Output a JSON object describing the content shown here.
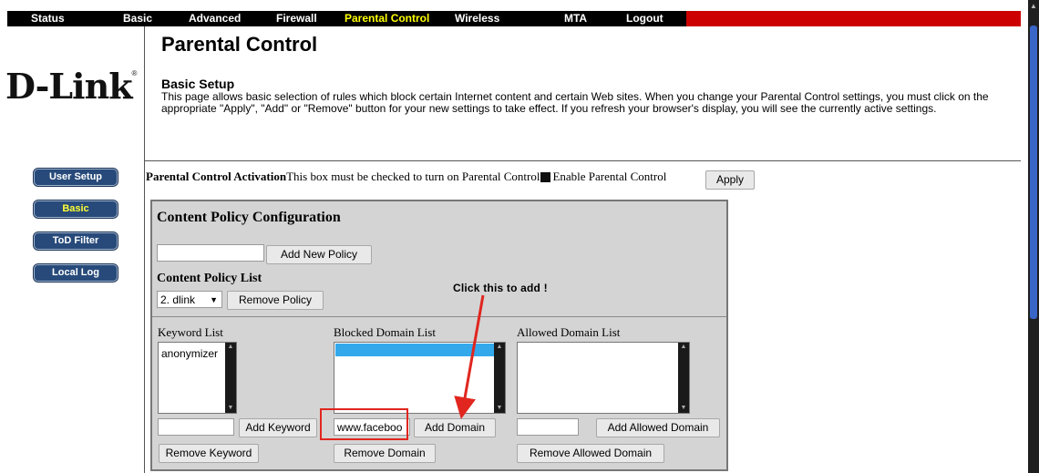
{
  "nav": {
    "items": [
      "Status",
      "Basic",
      "Advanced",
      "Firewall",
      "Parental Control",
      "Wireless",
      "MTA",
      "Logout"
    ],
    "active": "Parental Control"
  },
  "logo": {
    "text": "D-Link",
    "mark": "®"
  },
  "sidebar": {
    "items": [
      "User Setup",
      "Basic",
      "ToD Filter",
      "Local Log"
    ],
    "active": "Basic"
  },
  "header": {
    "title": "Parental Control",
    "section": "Basic Setup",
    "description": "This page allows basic selection of rules which block certain Internet content and certain Web sites. When you change your Parental Control settings, you must click on the appropriate \"Apply\", \"Add\" or \"Remove\" button for your new settings to take effect. If you refresh your browser's display, you will see the currently active settings."
  },
  "activation": {
    "label": "Parental Control Activation",
    "hint": "This box must be checked to turn on Parental Control",
    "checkbox_label": "Enable Parental Control",
    "apply": "Apply"
  },
  "policy": {
    "title": "Content Policy Configuration",
    "new_policy_value": "",
    "add_new_policy": "Add New Policy",
    "list_label": "Content Policy List",
    "selected": "2. dlink",
    "remove_policy": "Remove Policy"
  },
  "keyword": {
    "label": "Keyword List",
    "items": [
      "anonymizer"
    ],
    "input_value": "",
    "add": "Add Keyword",
    "remove": "Remove Keyword"
  },
  "blocked": {
    "label": "Blocked Domain List",
    "items": [
      ""
    ],
    "input_value": "www.faceboo",
    "add": "Add Domain",
    "remove": "Remove Domain"
  },
  "allowed": {
    "label": "Allowed Domain List",
    "items": [],
    "input_value": "",
    "add": "Add Allowed Domain",
    "remove": "Remove Allowed Domain"
  },
  "annotation": {
    "text": "Click this to add !",
    "color": "#e0261f"
  },
  "colors": {
    "nav_bar": "#cc0000",
    "nav_active": "#ffff00",
    "sidebar_button": "#274a7a",
    "panel": "#d4d4d4",
    "selection": "#33a9ec"
  }
}
